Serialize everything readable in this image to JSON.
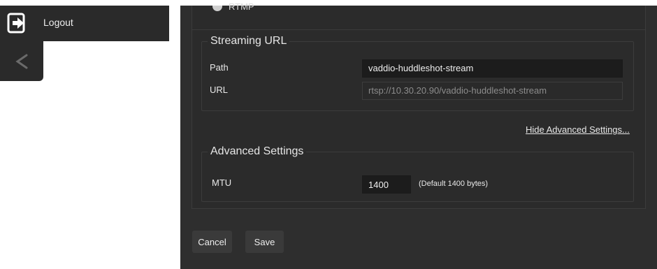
{
  "sidebar": {
    "logout_label": "Logout",
    "logout_icon": "logout-icon",
    "collapse_icon": "chevron-left-icon"
  },
  "protocol": {
    "radio_label": "RTMP"
  },
  "streaming_url": {
    "title": "Streaming URL",
    "path_label": "Path",
    "path_value": "vaddio-huddleshot-stream",
    "url_label": "URL",
    "url_value": "rtsp://10.30.20.90/vaddio-huddleshot-stream"
  },
  "advanced_toggle": {
    "label": "Hide Advanced Settings..."
  },
  "advanced": {
    "title": "Advanced Settings",
    "mtu_label": "MTU",
    "mtu_value": "1400",
    "mtu_hint": "(Default 1400 bytes)"
  },
  "actions": {
    "cancel_label": "Cancel",
    "save_label": "Save"
  },
  "colors": {
    "panel_bg": "#2e2e2e",
    "sidebar_bg": "#2a2a2a",
    "input_bg": "#1c1c1c",
    "text": "#e8e8e8"
  }
}
